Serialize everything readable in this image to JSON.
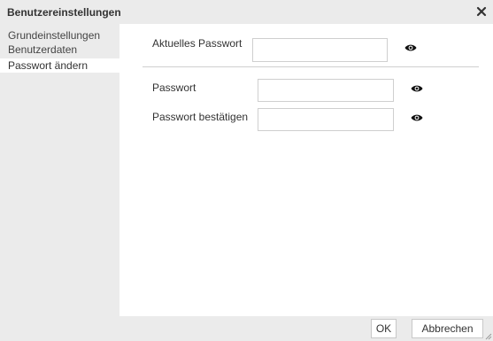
{
  "dialog": {
    "title": "Benutzereinstellungen",
    "close_icon": "close-icon"
  },
  "sidebar": {
    "items": [
      {
        "label": "Grundeinstellungen",
        "active": false
      },
      {
        "label": "Benutzerdaten",
        "active": false
      },
      {
        "label": "Passwort ändern",
        "active": true
      }
    ]
  },
  "form": {
    "current_password": {
      "label": "Aktuelles Passwort",
      "value": "",
      "icon": "eye-icon"
    },
    "new_password": {
      "label": "Passwort",
      "value": "",
      "icon": "eye-icon"
    },
    "confirm_password": {
      "label": "Passwort bestätigen",
      "value": "",
      "icon": "eye-icon"
    }
  },
  "footer": {
    "ok_label": "OK",
    "cancel_label": "Abbrechen"
  },
  "colors": {
    "panel_gray": "#ebebeb",
    "border": "#cfcfcf"
  }
}
